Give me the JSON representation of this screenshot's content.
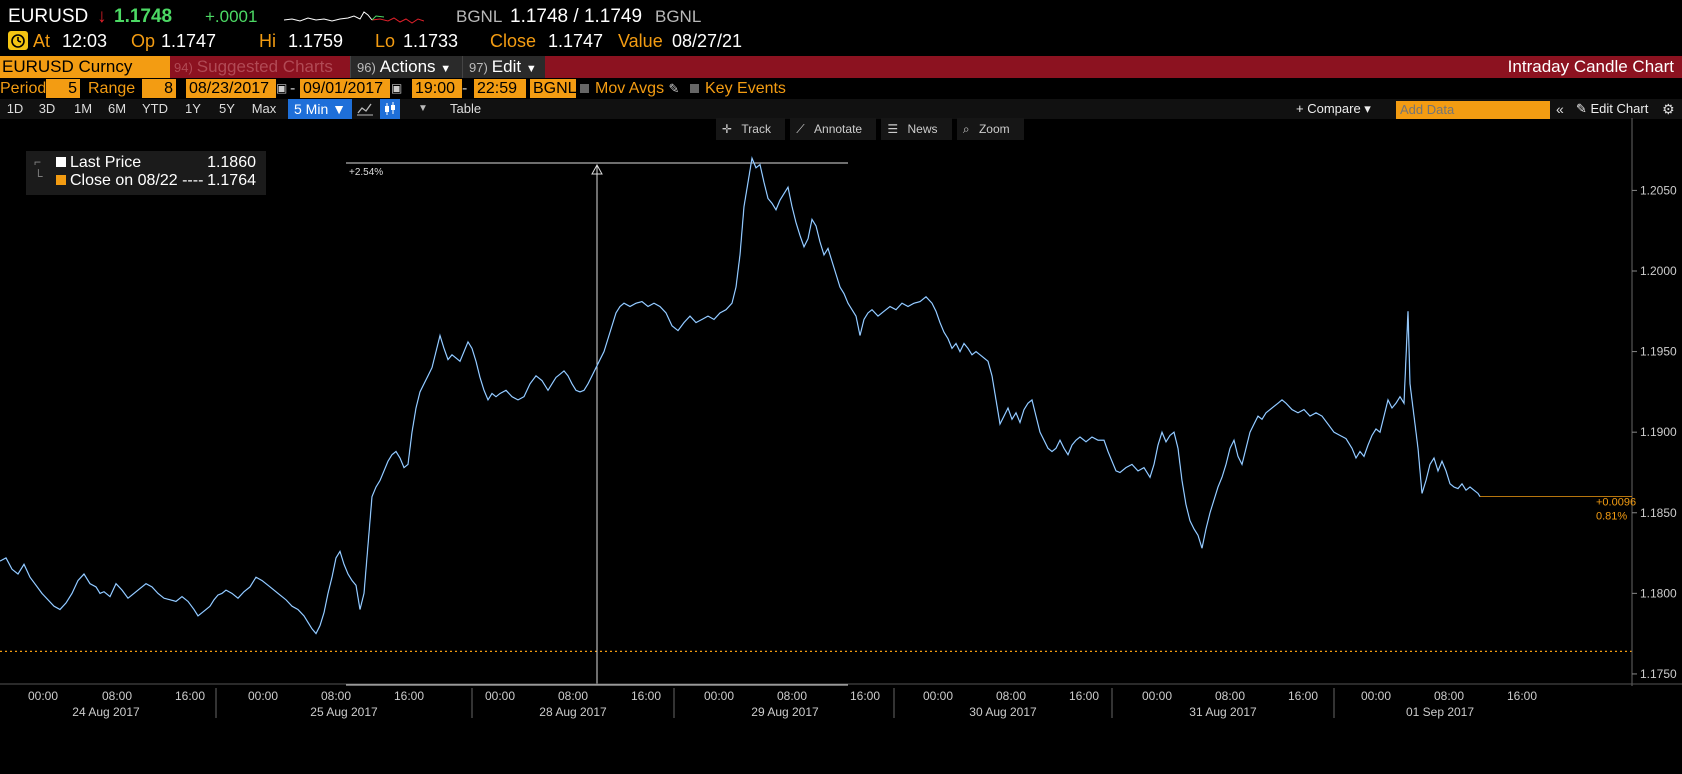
{
  "ticker": {
    "symbol": "EURUSD",
    "arrow": "↓",
    "last": "1.1748",
    "change": "+.0001",
    "source": "BGNL",
    "bid_ask": "1.1748 / 1.1749",
    "source2": "BGNL",
    "at_label": "At",
    "at_time": "12:03",
    "op_label": "Op",
    "op": "1.1747",
    "hi_label": "Hi",
    "hi": "1.1759",
    "lo_label": "Lo",
    "lo": "1.1733",
    "close_label": "Close",
    "close": "1.1747",
    "value_label": "Value",
    "value": "08/27/21"
  },
  "menubar": {
    "security": "EURUSD Curncy",
    "suggested_num": "94)",
    "suggested": "Suggested Charts",
    "actions_num": "96)",
    "actions": "Actions",
    "edit_num": "97)",
    "edit": "Edit",
    "title": "Intraday Candle Chart"
  },
  "settings": {
    "period_label": "Period",
    "period_value": "5",
    "range_label": "Range",
    "range_value": "8",
    "date_from": "08/23/2017",
    "date_to": "09/01/2017",
    "time_from": "19:00",
    "time_to": "22:59",
    "source": "BGNL",
    "mov_avgs": "Mov Avgs",
    "key_events": "Key Events"
  },
  "periods": [
    "1D",
    "3D",
    "1M",
    "6M",
    "YTD",
    "1Y",
    "5Y",
    "Max"
  ],
  "interval": "5 Min ▼",
  "table_label": "Table",
  "compare": "+ Compare ▾",
  "add_data_placeholder": "Add Data",
  "edit_chart": "Edit Chart",
  "chart_tools": [
    "Track",
    "Annotate",
    "News",
    "Zoom"
  ],
  "legend": {
    "last_price_label": "Last Price",
    "last_price_value": "1.1860",
    "close_label": "Close on 08/22 ----",
    "close_value": "1.1764"
  },
  "colors": {
    "accent": "#f39c12",
    "bar_red": "#8c1220",
    "line": "#4a9ae8",
    "up": "#4cd964",
    "down": "#e0202a"
  },
  "chart_data": {
    "type": "line",
    "series": [
      {
        "name": "Last Price"
      }
    ],
    "y_ticks": [
      "1.2050",
      "1.2000",
      "1.1950",
      "1.1900",
      "1.1850",
      "1.1800",
      "1.1750"
    ],
    "ylim": [
      1.1745,
      1.2085
    ],
    "x_time_ticks": [
      "00:00",
      "08:00",
      "16:00",
      "00:00",
      "08:00",
      "16:00",
      "00:00",
      "08:00",
      "16:00",
      "00:00",
      "08:00",
      "16:00",
      "00:00",
      "08:00",
      "16:00",
      "00:00",
      "08:00",
      "16:00",
      "00:00",
      "08:00",
      "16:00"
    ],
    "x_day_labels": [
      "24 Aug 2017",
      "25 Aug 2017",
      "28 Aug 2017",
      "29 Aug 2017",
      "30 Aug 2017",
      "31 Aug 2017",
      "01 Sep 2017"
    ],
    "reference_close": 1.1764,
    "measure_label": "+2.54%",
    "last_change": "+0.0096",
    "last_change_pct": "0.81%",
    "points": [
      [
        0,
        1.182
      ],
      [
        6,
        1.1822
      ],
      [
        12,
        1.1815
      ],
      [
        18,
        1.1812
      ],
      [
        24,
        1.1818
      ],
      [
        30,
        1.181
      ],
      [
        36,
        1.1805
      ],
      [
        42,
        1.18
      ],
      [
        48,
        1.1796
      ],
      [
        54,
        1.1792
      ],
      [
        60,
        1.179
      ],
      [
        66,
        1.1794
      ],
      [
        72,
        1.18
      ],
      [
        78,
        1.1808
      ],
      [
        84,
        1.1812
      ],
      [
        90,
        1.1806
      ],
      [
        96,
        1.1804
      ],
      [
        100,
        1.18
      ],
      [
        104,
        1.1801
      ],
      [
        110,
        1.1798
      ],
      [
        116,
        1.1806
      ],
      [
        122,
        1.1802
      ],
      [
        128,
        1.1797
      ],
      [
        134,
        1.18
      ],
      [
        140,
        1.1803
      ],
      [
        146,
        1.1806
      ],
      [
        152,
        1.1804
      ],
      [
        158,
        1.18
      ],
      [
        164,
        1.1797
      ],
      [
        170,
        1.1796
      ],
      [
        176,
        1.1795
      ],
      [
        182,
        1.1798
      ],
      [
        188,
        1.1795
      ],
      [
        194,
        1.179
      ],
      [
        198,
        1.1786
      ],
      [
        202,
        1.1788
      ],
      [
        206,
        1.179
      ],
      [
        210,
        1.1792
      ],
      [
        214,
        1.1796
      ],
      [
        218,
        1.1799
      ],
      [
        222,
        1.18
      ],
      [
        226,
        1.1802
      ],
      [
        232,
        1.18
      ],
      [
        238,
        1.1797
      ],
      [
        244,
        1.1801
      ],
      [
        250,
        1.1804
      ],
      [
        256,
        1.181
      ],
      [
        262,
        1.1808
      ],
      [
        268,
        1.1805
      ],
      [
        274,
        1.1802
      ],
      [
        280,
        1.1799
      ],
      [
        286,
        1.1796
      ],
      [
        292,
        1.1792
      ],
      [
        298,
        1.179
      ],
      [
        304,
        1.1786
      ],
      [
        308,
        1.1782
      ],
      [
        312,
        1.1778
      ],
      [
        316,
        1.1775
      ],
      [
        320,
        1.178
      ],
      [
        324,
        1.1788
      ],
      [
        328,
        1.18
      ],
      [
        332,
        1.181
      ],
      [
        336,
        1.1822
      ],
      [
        340,
        1.1826
      ],
      [
        344,
        1.1818
      ],
      [
        348,
        1.1812
      ],
      [
        352,
        1.1808
      ],
      [
        356,
        1.1805
      ],
      [
        360,
        1.179
      ],
      [
        364,
        1.18
      ],
      [
        368,
        1.183
      ],
      [
        372,
        1.186
      ],
      [
        376,
        1.1866
      ],
      [
        380,
        1.187
      ],
      [
        384,
        1.1876
      ],
      [
        388,
        1.1882
      ],
      [
        392,
        1.1886
      ],
      [
        396,
        1.1888
      ],
      [
        400,
        1.1884
      ],
      [
        404,
        1.1878
      ],
      [
        408,
        1.188
      ],
      [
        412,
        1.19
      ],
      [
        416,
        1.1915
      ],
      [
        420,
        1.1925
      ],
      [
        424,
        1.193
      ],
      [
        428,
        1.1935
      ],
      [
        432,
        1.194
      ],
      [
        436,
        1.195
      ],
      [
        440,
        1.196
      ],
      [
        444,
        1.1952
      ],
      [
        448,
        1.1945
      ],
      [
        452,
        1.1948
      ],
      [
        456,
        1.1946
      ],
      [
        460,
        1.1944
      ],
      [
        464,
        1.195
      ],
      [
        468,
        1.1956
      ],
      [
        472,
        1.1952
      ],
      [
        476,
        1.1944
      ],
      [
        480,
        1.1934
      ],
      [
        484,
        1.1926
      ],
      [
        488,
        1.192
      ],
      [
        492,
        1.1924
      ],
      [
        496,
        1.1922
      ],
      [
        500,
        1.1924
      ],
      [
        506,
        1.1926
      ],
      [
        512,
        1.1922
      ],
      [
        518,
        1.192
      ],
      [
        524,
        1.1922
      ],
      [
        530,
        1.193
      ],
      [
        536,
        1.1935
      ],
      [
        542,
        1.1932
      ],
      [
        548,
        1.1926
      ],
      [
        552,
        1.193
      ],
      [
        556,
        1.1934
      ],
      [
        560,
        1.1936
      ],
      [
        564,
        1.1938
      ],
      [
        568,
        1.1935
      ],
      [
        572,
        1.193
      ],
      [
        576,
        1.1926
      ],
      [
        580,
        1.1925
      ],
      [
        584,
        1.1926
      ],
      [
        588,
        1.193
      ],
      [
        592,
        1.1935
      ],
      [
        596,
        1.194
      ],
      [
        600,
        1.1945
      ],
      [
        604,
        1.195
      ],
      [
        608,
        1.1958
      ],
      [
        612,
        1.1966
      ],
      [
        616,
        1.1974
      ],
      [
        620,
        1.1978
      ],
      [
        624,
        1.198
      ],
      [
        630,
        1.1978
      ],
      [
        636,
        1.198
      ],
      [
        642,
        1.1981
      ],
      [
        648,
        1.1978
      ],
      [
        654,
        1.198
      ],
      [
        660,
        1.1978
      ],
      [
        666,
        1.1974
      ],
      [
        672,
        1.1966
      ],
      [
        678,
        1.1963
      ],
      [
        684,
        1.1968
      ],
      [
        690,
        1.1972
      ],
      [
        696,
        1.1968
      ],
      [
        702,
        1.197
      ],
      [
        708,
        1.1972
      ],
      [
        714,
        1.197
      ],
      [
        720,
        1.1974
      ],
      [
        726,
        1.1976
      ],
      [
        732,
        1.198
      ],
      [
        736,
        1.199
      ],
      [
        740,
        1.201
      ],
      [
        744,
        1.204
      ],
      [
        748,
        1.2055
      ],
      [
        752,
        1.207
      ],
      [
        756,
        1.2064
      ],
      [
        760,
        1.2066
      ],
      [
        764,
        1.2055
      ],
      [
        768,
        1.2045
      ],
      [
        772,
        1.2042
      ],
      [
        776,
        1.2038
      ],
      [
        780,
        1.2044
      ],
      [
        784,
        1.2048
      ],
      [
        788,
        1.2052
      ],
      [
        792,
        1.204
      ],
      [
        796,
        1.203
      ],
      [
        800,
        1.2022
      ],
      [
        804,
        1.2015
      ],
      [
        808,
        1.202
      ],
      [
        812,
        1.2032
      ],
      [
        816,
        1.2028
      ],
      [
        820,
        1.2018
      ],
      [
        824,
        1.201
      ],
      [
        828,
        1.2014
      ],
      [
        832,
        1.2006
      ],
      [
        836,
        1.1998
      ],
      [
        840,
        1.199
      ],
      [
        844,
        1.1986
      ],
      [
        848,
        1.198
      ],
      [
        852,
        1.1976
      ],
      [
        856,
        1.1972
      ],
      [
        860,
        1.196
      ],
      [
        864,
        1.197
      ],
      [
        868,
        1.1974
      ],
      [
        872,
        1.1976
      ],
      [
        878,
        1.1972
      ],
      [
        884,
        1.1975
      ],
      [
        890,
        1.1978
      ],
      [
        896,
        1.1976
      ],
      [
        902,
        1.198
      ],
      [
        908,
        1.1978
      ],
      [
        914,
        1.198
      ],
      [
        920,
        1.1981
      ],
      [
        926,
        1.1984
      ],
      [
        932,
        1.198
      ],
      [
        936,
        1.1975
      ],
      [
        940,
        1.1968
      ],
      [
        944,
        1.1962
      ],
      [
        948,
        1.1958
      ],
      [
        952,
        1.1952
      ],
      [
        956,
        1.1955
      ],
      [
        960,
        1.195
      ],
      [
        964,
        1.1955
      ],
      [
        968,
        1.1952
      ],
      [
        972,
        1.1948
      ],
      [
        976,
        1.195
      ],
      [
        980,
        1.1948
      ],
      [
        984,
        1.1946
      ],
      [
        988,
        1.1944
      ],
      [
        992,
        1.1935
      ],
      [
        996,
        1.192
      ],
      [
        1000,
        1.1905
      ],
      [
        1004,
        1.191
      ],
      [
        1008,
        1.1915
      ],
      [
        1012,
        1.1908
      ],
      [
        1016,
        1.1912
      ],
      [
        1020,
        1.1906
      ],
      [
        1024,
        1.1914
      ],
      [
        1028,
        1.1918
      ],
      [
        1032,
        1.192
      ],
      [
        1036,
        1.191
      ],
      [
        1040,
        1.19
      ],
      [
        1044,
        1.1895
      ],
      [
        1048,
        1.189
      ],
      [
        1052,
        1.1888
      ],
      [
        1056,
        1.189
      ],
      [
        1060,
        1.1895
      ],
      [
        1064,
        1.189
      ],
      [
        1068,
        1.1886
      ],
      [
        1072,
        1.1892
      ],
      [
        1076,
        1.1895
      ],
      [
        1080,
        1.1897
      ],
      [
        1086,
        1.1894
      ],
      [
        1092,
        1.1897
      ],
      [
        1098,
        1.1895
      ],
      [
        1104,
        1.1895
      ],
      [
        1108,
        1.1888
      ],
      [
        1112,
        1.1882
      ],
      [
        1116,
        1.1876
      ],
      [
        1120,
        1.1875
      ],
      [
        1126,
        1.1878
      ],
      [
        1132,
        1.188
      ],
      [
        1138,
        1.1876
      ],
      [
        1144,
        1.1878
      ],
      [
        1150,
        1.1872
      ],
      [
        1154,
        1.188
      ],
      [
        1158,
        1.1892
      ],
      [
        1162,
        1.19
      ],
      [
        1166,
        1.1894
      ],
      [
        1170,
        1.1898
      ],
      [
        1174,
        1.19
      ],
      [
        1178,
        1.189
      ],
      [
        1182,
        1.187
      ],
      [
        1186,
        1.1855
      ],
      [
        1190,
        1.1845
      ],
      [
        1194,
        1.184
      ],
      [
        1198,
        1.1836
      ],
      [
        1202,
        1.1828
      ],
      [
        1206,
        1.184
      ],
      [
        1210,
        1.185
      ],
      [
        1214,
        1.1858
      ],
      [
        1218,
        1.1866
      ],
      [
        1222,
        1.1872
      ],
      [
        1226,
        1.188
      ],
      [
        1230,
        1.189
      ],
      [
        1234,
        1.1895
      ],
      [
        1238,
        1.1885
      ],
      [
        1242,
        1.188
      ],
      [
        1246,
        1.189
      ],
      [
        1250,
        1.19
      ],
      [
        1254,
        1.1905
      ],
      [
        1258,
        1.191
      ],
      [
        1262,
        1.1908
      ],
      [
        1266,
        1.1912
      ],
      [
        1270,
        1.1914
      ],
      [
        1274,
        1.1916
      ],
      [
        1278,
        1.1918
      ],
      [
        1282,
        1.192
      ],
      [
        1286,
        1.1918
      ],
      [
        1292,
        1.1914
      ],
      [
        1298,
        1.1912
      ],
      [
        1304,
        1.1914
      ],
      [
        1310,
        1.191
      ],
      [
        1316,
        1.1912
      ],
      [
        1322,
        1.191
      ],
      [
        1328,
        1.1905
      ],
      [
        1334,
        1.19
      ],
      [
        1340,
        1.1898
      ],
      [
        1346,
        1.1896
      ],
      [
        1352,
        1.189
      ],
      [
        1356,
        1.1884
      ],
      [
        1360,
        1.1888
      ],
      [
        1364,
        1.1885
      ],
      [
        1368,
        1.1892
      ],
      [
        1372,
        1.1898
      ],
      [
        1376,
        1.1902
      ],
      [
        1380,
        1.19
      ],
      [
        1384,
        1.191
      ],
      [
        1388,
        1.192
      ],
      [
        1392,
        1.1915
      ],
      [
        1396,
        1.1918
      ],
      [
        1400,
        1.1922
      ],
      [
        1404,
        1.1918
      ],
      [
        1408,
        1.1975
      ],
      [
        1410,
        1.193
      ],
      [
        1414,
        1.191
      ],
      [
        1418,
        1.189
      ],
      [
        1422,
        1.1862
      ],
      [
        1426,
        1.187
      ],
      [
        1430,
        1.188
      ],
      [
        1434,
        1.1884
      ],
      [
        1438,
        1.1876
      ],
      [
        1442,
        1.1882
      ],
      [
        1446,
        1.1876
      ],
      [
        1450,
        1.1868
      ],
      [
        1454,
        1.1866
      ],
      [
        1458,
        1.1865
      ],
      [
        1462,
        1.1868
      ],
      [
        1466,
        1.1864
      ],
      [
        1470,
        1.1866
      ],
      [
        1474,
        1.1864
      ],
      [
        1478,
        1.1862
      ],
      [
        1480,
        1.186
      ]
    ]
  }
}
